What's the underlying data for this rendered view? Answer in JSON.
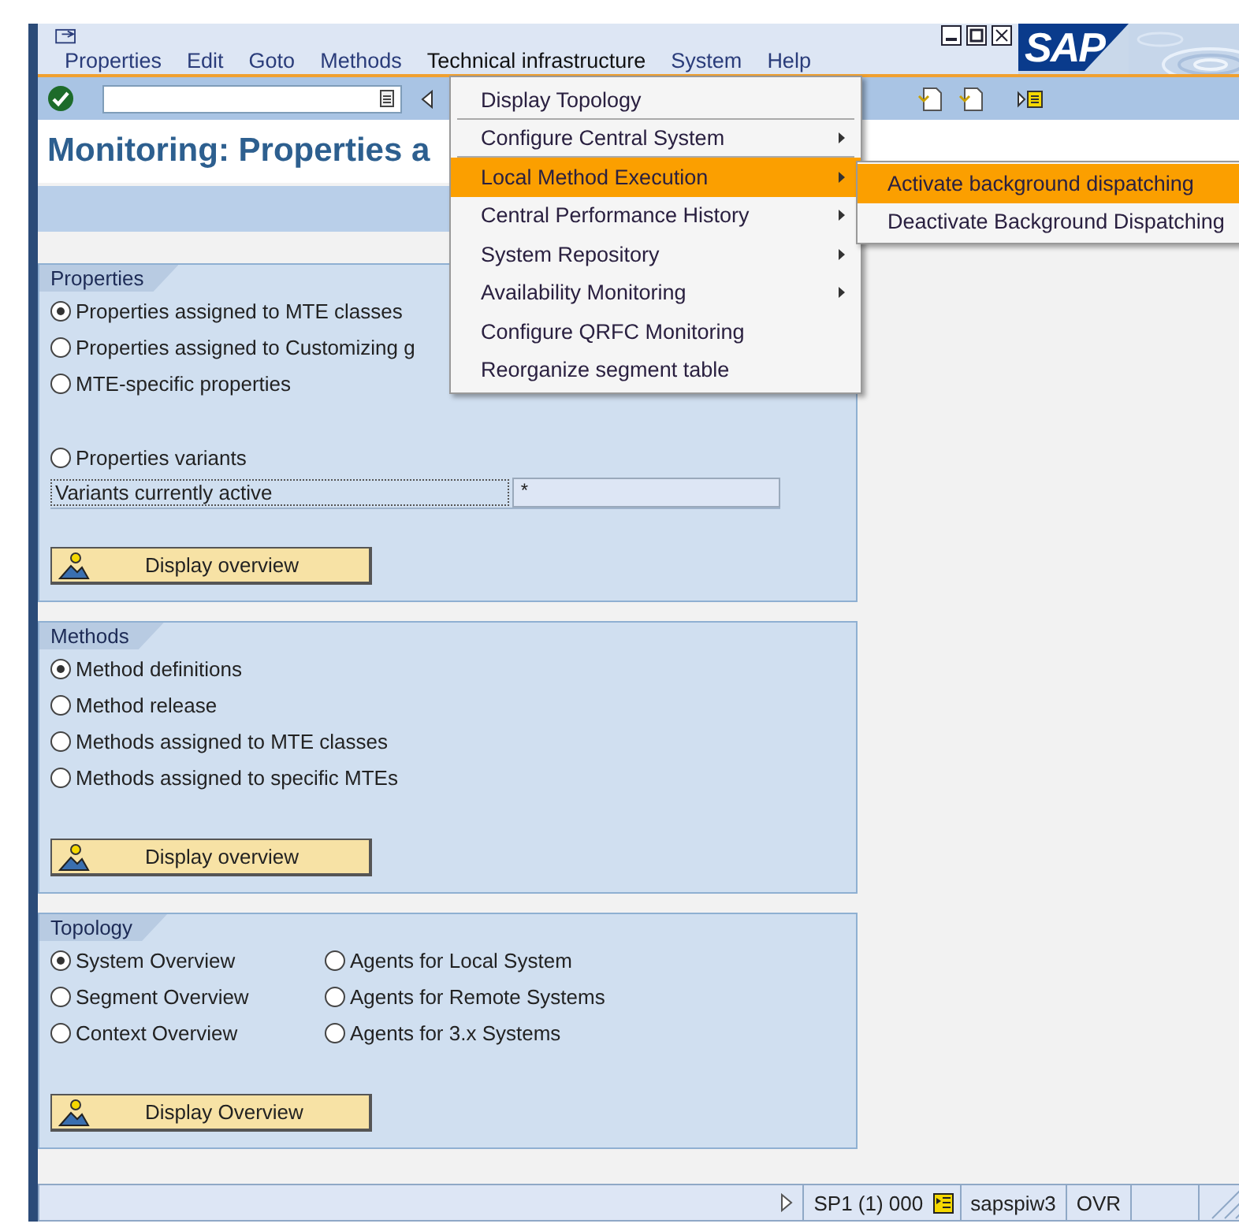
{
  "logo": "SAP",
  "menu_bar": [
    {
      "label": "Properties",
      "open": false
    },
    {
      "label": "Edit",
      "open": false
    },
    {
      "label": "Goto",
      "open": false
    },
    {
      "label": "Methods",
      "open": false
    },
    {
      "label": "Technical infrastructure",
      "open": true
    },
    {
      "label": "System",
      "open": false
    },
    {
      "label": "Help",
      "open": false
    }
  ],
  "title": "Monitoring: Properties a",
  "dropdown": [
    {
      "label": "Display Topology",
      "submenu": false,
      "selected": false,
      "separator_after": true
    },
    {
      "label": "Configure Central System",
      "submenu": true,
      "selected": false,
      "separator_after": true
    },
    {
      "label": "Local Method Execution",
      "submenu": true,
      "selected": true,
      "separator_after": false
    },
    {
      "label": "Central Performance History",
      "submenu": true,
      "selected": false,
      "separator_after": false
    },
    {
      "label": "System Repository",
      "submenu": true,
      "selected": false,
      "separator_after": false
    },
    {
      "label": "Availability Monitoring",
      "submenu": true,
      "selected": false,
      "separator_after": false
    },
    {
      "label": "Configure QRFC Monitoring",
      "submenu": false,
      "selected": false,
      "separator_after": false
    },
    {
      "label": "Reorganize segment table",
      "submenu": false,
      "selected": false,
      "separator_after": false
    }
  ],
  "submenu": [
    {
      "label": "Activate background dispatching",
      "selected": true
    },
    {
      "label": "Deactivate Background Dispatching",
      "selected": false
    }
  ],
  "groups": [
    {
      "title": "Properties",
      "option_columns": [
        [
          {
            "label": "Properties assigned to MTE classes",
            "selected": true
          },
          {
            "label": "Properties assigned to Customizing g",
            "selected": false
          },
          {
            "label": "MTE-specific properties",
            "selected": false
          }
        ]
      ],
      "variant_option": {
        "label": "Properties variants",
        "selected": false
      },
      "variants_field": {
        "label": "Variants currently active",
        "value": "*"
      },
      "button": "Display overview"
    },
    {
      "title": "Methods",
      "option_columns": [
        [
          {
            "label": "Method definitions",
            "selected": true
          },
          {
            "label": "Method release",
            "selected": false
          },
          {
            "label": "Methods assigned to MTE classes",
            "selected": false
          },
          {
            "label": "Methods assigned to specific MTEs",
            "selected": false
          }
        ]
      ],
      "button": "Display overview"
    },
    {
      "title": "Topology",
      "option_columns": [
        [
          {
            "label": "System Overview",
            "selected": true
          },
          {
            "label": "Segment Overview",
            "selected": false
          },
          {
            "label": "Context Overview",
            "selected": false
          }
        ],
        [
          {
            "label": "Agents for Local System",
            "selected": false
          },
          {
            "label": "Agents for Remote Systems",
            "selected": false
          },
          {
            "label": "Agents for 3.x Systems",
            "selected": false
          }
        ]
      ],
      "button": "Display Overview"
    }
  ],
  "status_bar": {
    "system": "SP1 (1) 000",
    "server": "sapspiw3",
    "mode": "OVR"
  }
}
